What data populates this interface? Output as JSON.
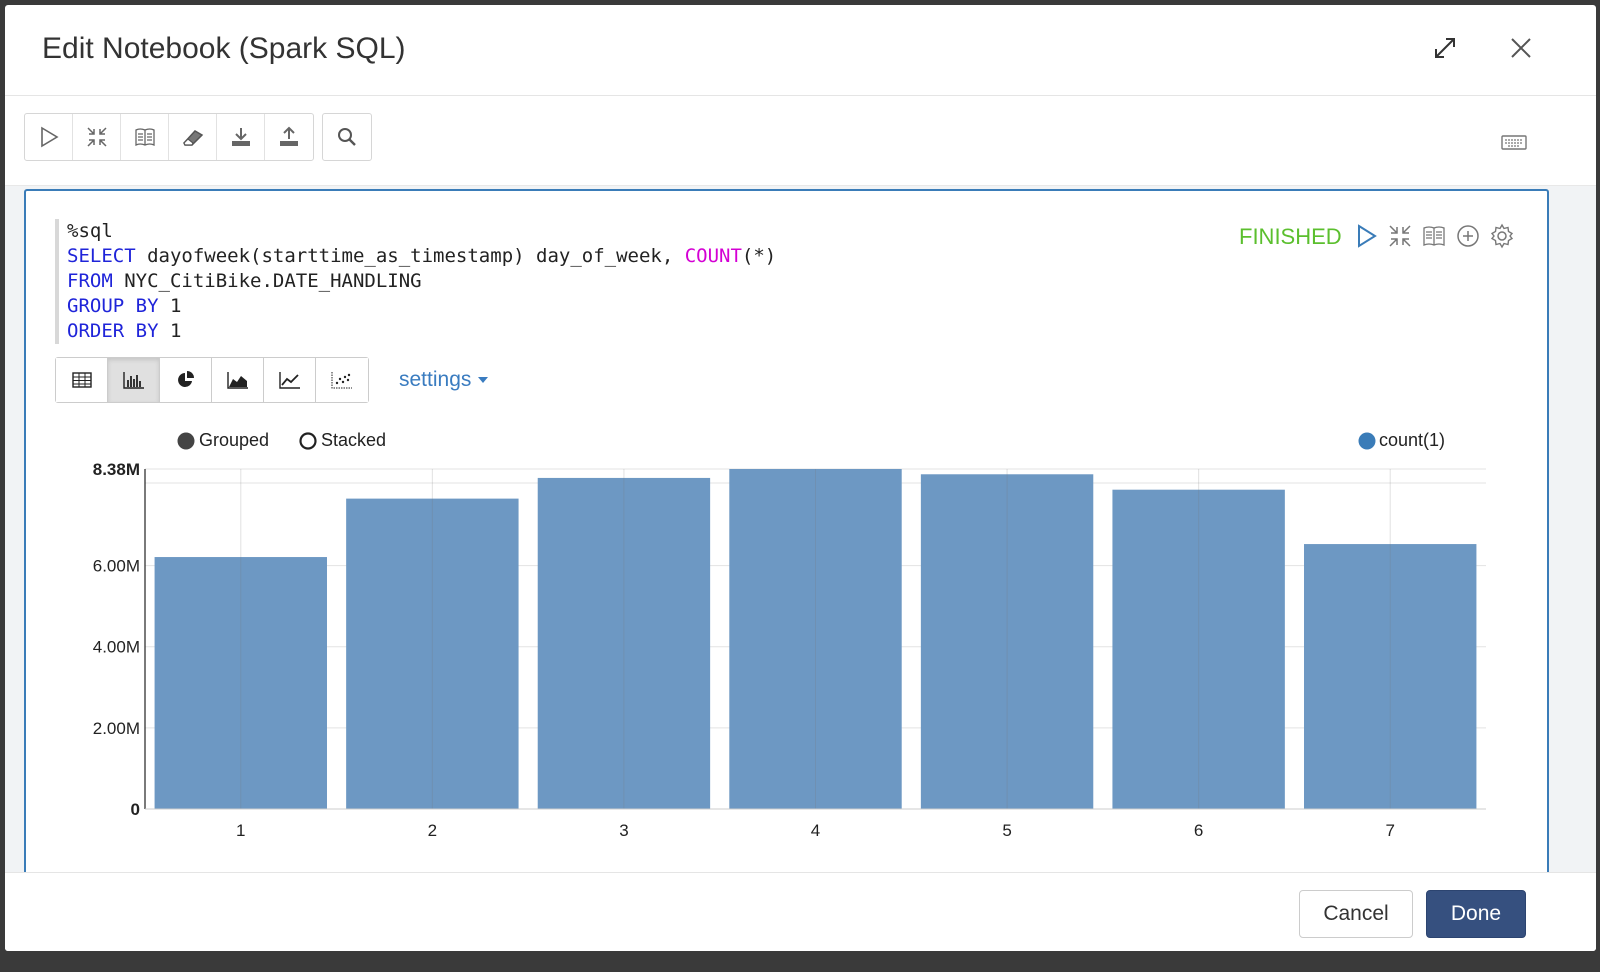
{
  "dialog": {
    "title": "Edit Notebook (Spark SQL)"
  },
  "paragraph": {
    "status": "FINISHED",
    "code": {
      "line1": "%sql",
      "select_kw": "SELECT",
      "select_rest": " dayofweek(starttime_as_timestamp) day_of_week, ",
      "count_fn": "COUNT",
      "count_args": "(*)",
      "from_kw": "FROM",
      "from_rest": " NYC_CitiBike.DATE_HANDLING",
      "group_kw": "GROUP BY",
      "group_rest": " 1",
      "order_kw": "ORDER BY",
      "order_rest": " 1"
    },
    "settings_label": "settings",
    "grouped_label": "Grouped",
    "stacked_label": "Stacked",
    "series_legend": "count(1)"
  },
  "footer": {
    "cancel_label": "Cancel",
    "done_label": "Done"
  },
  "colors": {
    "accent": "#3a7cb8",
    "bar": "#6d98c3",
    "status": "#5bbf2e",
    "done_button": "#36507f"
  },
  "chart_data": {
    "type": "bar",
    "categories": [
      "1",
      "2",
      "3",
      "4",
      "5",
      "6",
      "7"
    ],
    "series": [
      {
        "name": "count(1)",
        "values": [
          6210000,
          7650000,
          8160000,
          8380000,
          8250000,
          7870000,
          6530000
        ]
      }
    ],
    "ylim": [
      0,
      8380000
    ],
    "yticks": [
      "0",
      "2.00M",
      "4.00M",
      "6.00M",
      "8.38M"
    ],
    "ytick_values": [
      0,
      2000000,
      4000000,
      6000000,
      8380000
    ],
    "grid": true,
    "legend_position": "top-right"
  }
}
